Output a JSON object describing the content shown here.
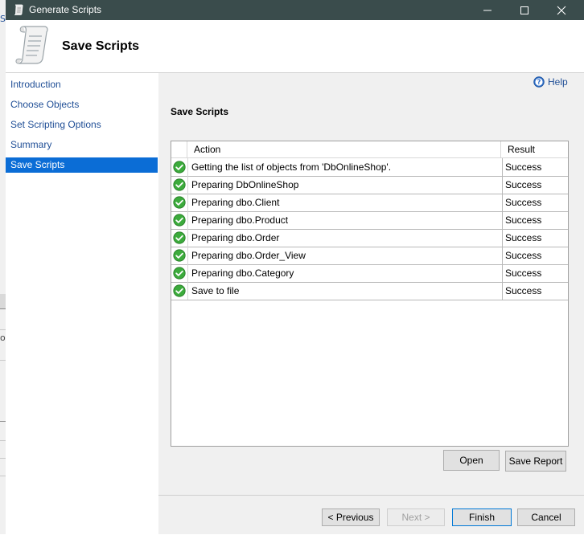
{
  "window": {
    "title": "Generate Scripts"
  },
  "header": {
    "title": "Save Scripts"
  },
  "nav": {
    "items": [
      {
        "label": "Introduction"
      },
      {
        "label": "Choose Objects"
      },
      {
        "label": "Set Scripting Options"
      },
      {
        "label": "Summary"
      },
      {
        "label": "Save Scripts",
        "selected": true
      }
    ]
  },
  "content": {
    "help_label": "Help",
    "section_title": "Save Scripts",
    "grid": {
      "columns": [
        "Action",
        "Result"
      ],
      "rows": [
        {
          "icon": "success-check-icon",
          "action": "Getting the list of objects from 'DbOnlineShop'.",
          "result": "Success"
        },
        {
          "icon": "success-check-icon",
          "action": "Preparing DbOnlineShop",
          "result": "Success"
        },
        {
          "icon": "success-check-icon",
          "action": "Preparing dbo.Client",
          "result": "Success"
        },
        {
          "icon": "success-check-icon",
          "action": "Preparing dbo.Product",
          "result": "Success"
        },
        {
          "icon": "success-check-icon",
          "action": "Preparing dbo.Order",
          "result": "Success"
        },
        {
          "icon": "success-check-icon",
          "action": "Preparing dbo.Order_View",
          "result": "Success"
        },
        {
          "icon": "success-check-icon",
          "action": "Preparing dbo.Category",
          "result": "Success"
        },
        {
          "icon": "success-check-icon",
          "action": "Save to file",
          "result": "Success"
        }
      ]
    },
    "open_label": "Open",
    "save_report_label": "Save Report"
  },
  "footer": {
    "previous_label": "< Previous",
    "next_label": "Next >",
    "finish_label": "Finish",
    "cancel_label": "Cancel"
  },
  "background": {
    "glyph_1": "S",
    "glyph_2": "o"
  },
  "colors": {
    "titlebar": "#3a4c4c",
    "nav_selected": "#0b6dd6",
    "link": "#1f4e96",
    "success": "#3cab3c"
  }
}
